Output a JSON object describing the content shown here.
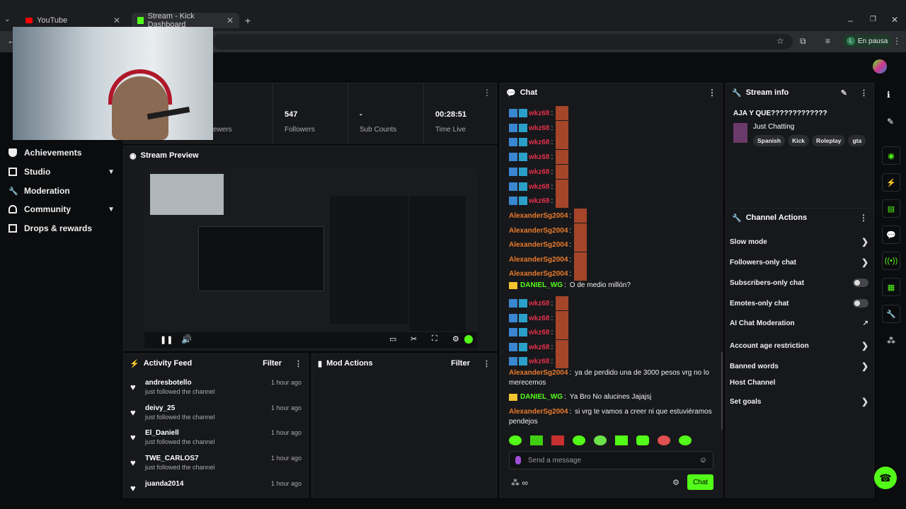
{
  "browser": {
    "tabs": [
      {
        "label": "YouTube"
      },
      {
        "label": "Stream - Kick Dashboard"
      }
    ],
    "profile_label": "En pausa"
  },
  "sidebar": {
    "items": [
      {
        "label": "Achievements"
      },
      {
        "label": "Studio"
      },
      {
        "label": "Moderation"
      },
      {
        "label": "Community"
      },
      {
        "label": "Drops & rewards"
      }
    ]
  },
  "stats": {
    "viewers_label": "ewers",
    "followers_value": "547",
    "followers_label": "Followers",
    "subs_value": "-",
    "subs_label": "Sub Counts",
    "time_value": "00:28:51",
    "time_label": "Time Live"
  },
  "stream_preview": {
    "title": "Stream Preview"
  },
  "activity_feed": {
    "title": "Activity Feed",
    "filter": "Filter",
    "items": [
      {
        "name": "andresbotello",
        "text": "just followed the channel",
        "time": "1 hour ago"
      },
      {
        "name": "deivy_25",
        "text": "just followed the channel",
        "time": "1 hour ago"
      },
      {
        "name": "El_Daniell",
        "text": "just followed the channel",
        "time": "1 hour ago"
      },
      {
        "name": "TWE_CARLOS7",
        "text": "just followed the channel",
        "time": "1 hour ago"
      },
      {
        "name": "juanda2014",
        "text": "",
        "time": "1 hour ago"
      }
    ]
  },
  "mod_actions": {
    "title": "Mod Actions",
    "filter": "Filter"
  },
  "chat": {
    "title": "Chat",
    "messages": [
      {
        "user": "wkz68",
        "sep": ":",
        "text": ""
      },
      {
        "user": "wkz68",
        "sep": ":",
        "text": ""
      },
      {
        "user": "wkz68",
        "sep": ":",
        "text": ""
      },
      {
        "user": "wkz68",
        "sep": ":",
        "text": ""
      },
      {
        "user": "wkz68",
        "sep": ":",
        "text": ""
      },
      {
        "user": "wkz68",
        "sep": ":",
        "text": ""
      },
      {
        "user": "wkz68",
        "sep": ":",
        "text": ""
      },
      {
        "user": "AlexanderSg2004",
        "sep": ":",
        "text": ""
      },
      {
        "user": "AlexanderSg2004",
        "sep": ":",
        "text": ""
      },
      {
        "user": "AlexanderSg2004",
        "sep": ":",
        "text": ""
      },
      {
        "user": "AlexanderSg2004",
        "sep": ":",
        "text": ""
      },
      {
        "user": "AlexanderSg2004",
        "sep": ":",
        "text": ""
      },
      {
        "user": "DANIEL_WG",
        "sep": ":",
        "text": "O de medio millón?"
      },
      {
        "user": "wkz68",
        "sep": ":",
        "text": ""
      },
      {
        "user": "wkz68",
        "sep": ":",
        "text": ""
      },
      {
        "user": "wkz68",
        "sep": ":",
        "text": ""
      },
      {
        "user": "wkz68",
        "sep": ":",
        "text": ""
      },
      {
        "user": "wkz68",
        "sep": ":",
        "text": ""
      },
      {
        "user": "AlexanderSg2004",
        "sep": ":",
        "text": "ya de perdido una de 3000 pesos vrg no lo",
        "text2": "merecemos"
      },
      {
        "user": "DANIEL_WG",
        "sep": ":",
        "text": "Ya Bro No alucines Jajajsj"
      },
      {
        "user": "AlexanderSg2004",
        "sep": ":",
        "text": "si vrg te vamos a creer ni que estuviéramos",
        "text2": "pendejos"
      }
    ],
    "input_placeholder": "Send a message",
    "send_label": "Chat"
  },
  "stream_info": {
    "title": "Stream info",
    "stream_title": "AJA Y QUE?????????????",
    "category": "Just Chatting",
    "tags": [
      "Spanish",
      "Kick",
      "Roleplay",
      "gta"
    ]
  },
  "channel_actions": {
    "title": "Channel Actions",
    "items": [
      {
        "label": "Slow mode"
      },
      {
        "label": "Followers-only chat"
      },
      {
        "label": "Subscribers-only chat"
      },
      {
        "label": "Emotes-only chat"
      },
      {
        "label": "AI Chat Moderation"
      },
      {
        "label": "Account age restriction"
      },
      {
        "label": "Banned words"
      },
      {
        "label": "Host Channel"
      },
      {
        "label": "Set goals"
      }
    ]
  },
  "colors": {
    "accent": "#53fc18",
    "bg": "#0b0c0e",
    "panel": "#17181b"
  }
}
